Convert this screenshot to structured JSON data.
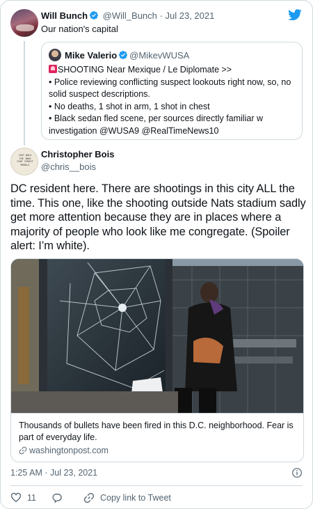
{
  "parent": {
    "name": "Will Bunch",
    "handle": "@Will_Bunch",
    "separator": "·",
    "date": "Jul 23, 2021",
    "text": "Our nation's capital"
  },
  "quote": {
    "name": "Mike Valerio",
    "handle": "@MikevWUSA",
    "lines": [
      "SHOOTING Near Mexique / Le Diplomate >>",
      "• Police reviewing conflicting suspect lookouts right now, so, no solid suspect descriptions.",
      "• No deaths, 1 shot in arm, 1 shot in chest",
      "• Black sedan fled scene, per sources directly familiar w investigation @WUSA9 @RealTimeNews10"
    ]
  },
  "tweet": {
    "name": "Christopher Bois",
    "handle": "@chris__bois",
    "avatar_sign": [
      "JUST WALK",
      "THE 3000",
      "FOOT STREET",
      "MURALS"
    ],
    "text": "DC resident here. There are shootings in this city ALL the time. This one, like the shooting outside Nats stadium sadly get more attention  because they are in places where a majority of people who look like me congregate. (Spoiler alert: I’m white).",
    "link_card": {
      "title": "Thousands of bullets have been fired in this D.C. neighborhood. Fear is part of everyday life.",
      "domain": "washingtonpost.com"
    },
    "time": "1:25 AM",
    "date": "Jul 23, 2021",
    "separator": "·"
  },
  "actions": {
    "likes": "11",
    "copy_link": "Copy link to Tweet"
  },
  "colors": {
    "twitter_blue": "#1d9bf0",
    "like_red": "#f91880",
    "muted": "#536471",
    "border": "#cfd9de"
  }
}
